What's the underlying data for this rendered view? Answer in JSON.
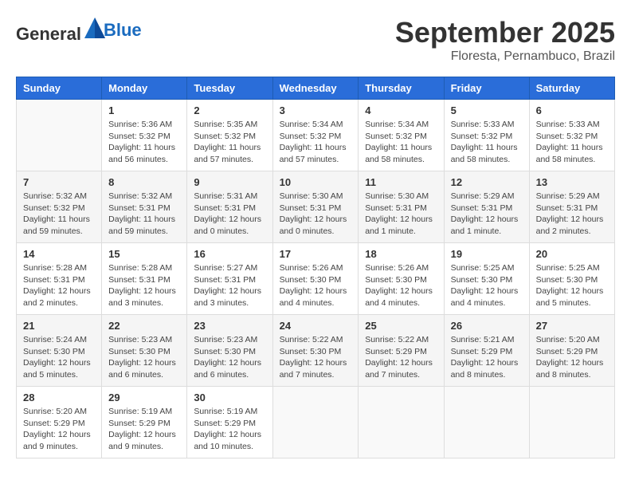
{
  "header": {
    "logo_general": "General",
    "logo_blue": "Blue",
    "month_title": "September 2025",
    "subtitle": "Floresta, Pernambuco, Brazil"
  },
  "days_of_week": [
    "Sunday",
    "Monday",
    "Tuesday",
    "Wednesday",
    "Thursday",
    "Friday",
    "Saturday"
  ],
  "weeks": [
    [
      {
        "day": "",
        "info": ""
      },
      {
        "day": "1",
        "info": "Sunrise: 5:36 AM\nSunset: 5:32 PM\nDaylight: 11 hours\nand 56 minutes."
      },
      {
        "day": "2",
        "info": "Sunrise: 5:35 AM\nSunset: 5:32 PM\nDaylight: 11 hours\nand 57 minutes."
      },
      {
        "day": "3",
        "info": "Sunrise: 5:34 AM\nSunset: 5:32 PM\nDaylight: 11 hours\nand 57 minutes."
      },
      {
        "day": "4",
        "info": "Sunrise: 5:34 AM\nSunset: 5:32 PM\nDaylight: 11 hours\nand 58 minutes."
      },
      {
        "day": "5",
        "info": "Sunrise: 5:33 AM\nSunset: 5:32 PM\nDaylight: 11 hours\nand 58 minutes."
      },
      {
        "day": "6",
        "info": "Sunrise: 5:33 AM\nSunset: 5:32 PM\nDaylight: 11 hours\nand 58 minutes."
      }
    ],
    [
      {
        "day": "7",
        "info": "Sunrise: 5:32 AM\nSunset: 5:32 PM\nDaylight: 11 hours\nand 59 minutes."
      },
      {
        "day": "8",
        "info": "Sunrise: 5:32 AM\nSunset: 5:31 PM\nDaylight: 11 hours\nand 59 minutes."
      },
      {
        "day": "9",
        "info": "Sunrise: 5:31 AM\nSunset: 5:31 PM\nDaylight: 12 hours\nand 0 minutes."
      },
      {
        "day": "10",
        "info": "Sunrise: 5:30 AM\nSunset: 5:31 PM\nDaylight: 12 hours\nand 0 minutes."
      },
      {
        "day": "11",
        "info": "Sunrise: 5:30 AM\nSunset: 5:31 PM\nDaylight: 12 hours\nand 1 minute."
      },
      {
        "day": "12",
        "info": "Sunrise: 5:29 AM\nSunset: 5:31 PM\nDaylight: 12 hours\nand 1 minute."
      },
      {
        "day": "13",
        "info": "Sunrise: 5:29 AM\nSunset: 5:31 PM\nDaylight: 12 hours\nand 2 minutes."
      }
    ],
    [
      {
        "day": "14",
        "info": "Sunrise: 5:28 AM\nSunset: 5:31 PM\nDaylight: 12 hours\nand 2 minutes."
      },
      {
        "day": "15",
        "info": "Sunrise: 5:28 AM\nSunset: 5:31 PM\nDaylight: 12 hours\nand 3 minutes."
      },
      {
        "day": "16",
        "info": "Sunrise: 5:27 AM\nSunset: 5:31 PM\nDaylight: 12 hours\nand 3 minutes."
      },
      {
        "day": "17",
        "info": "Sunrise: 5:26 AM\nSunset: 5:30 PM\nDaylight: 12 hours\nand 4 minutes."
      },
      {
        "day": "18",
        "info": "Sunrise: 5:26 AM\nSunset: 5:30 PM\nDaylight: 12 hours\nand 4 minutes."
      },
      {
        "day": "19",
        "info": "Sunrise: 5:25 AM\nSunset: 5:30 PM\nDaylight: 12 hours\nand 4 minutes."
      },
      {
        "day": "20",
        "info": "Sunrise: 5:25 AM\nSunset: 5:30 PM\nDaylight: 12 hours\nand 5 minutes."
      }
    ],
    [
      {
        "day": "21",
        "info": "Sunrise: 5:24 AM\nSunset: 5:30 PM\nDaylight: 12 hours\nand 5 minutes."
      },
      {
        "day": "22",
        "info": "Sunrise: 5:23 AM\nSunset: 5:30 PM\nDaylight: 12 hours\nand 6 minutes."
      },
      {
        "day": "23",
        "info": "Sunrise: 5:23 AM\nSunset: 5:30 PM\nDaylight: 12 hours\nand 6 minutes."
      },
      {
        "day": "24",
        "info": "Sunrise: 5:22 AM\nSunset: 5:30 PM\nDaylight: 12 hours\nand 7 minutes."
      },
      {
        "day": "25",
        "info": "Sunrise: 5:22 AM\nSunset: 5:29 PM\nDaylight: 12 hours\nand 7 minutes."
      },
      {
        "day": "26",
        "info": "Sunrise: 5:21 AM\nSunset: 5:29 PM\nDaylight: 12 hours\nand 8 minutes."
      },
      {
        "day": "27",
        "info": "Sunrise: 5:20 AM\nSunset: 5:29 PM\nDaylight: 12 hours\nand 8 minutes."
      }
    ],
    [
      {
        "day": "28",
        "info": "Sunrise: 5:20 AM\nSunset: 5:29 PM\nDaylight: 12 hours\nand 9 minutes."
      },
      {
        "day": "29",
        "info": "Sunrise: 5:19 AM\nSunset: 5:29 PM\nDaylight: 12 hours\nand 9 minutes."
      },
      {
        "day": "30",
        "info": "Sunrise: 5:19 AM\nSunset: 5:29 PM\nDaylight: 12 hours\nand 10 minutes."
      },
      {
        "day": "",
        "info": ""
      },
      {
        "day": "",
        "info": ""
      },
      {
        "day": "",
        "info": ""
      },
      {
        "day": "",
        "info": ""
      }
    ]
  ]
}
